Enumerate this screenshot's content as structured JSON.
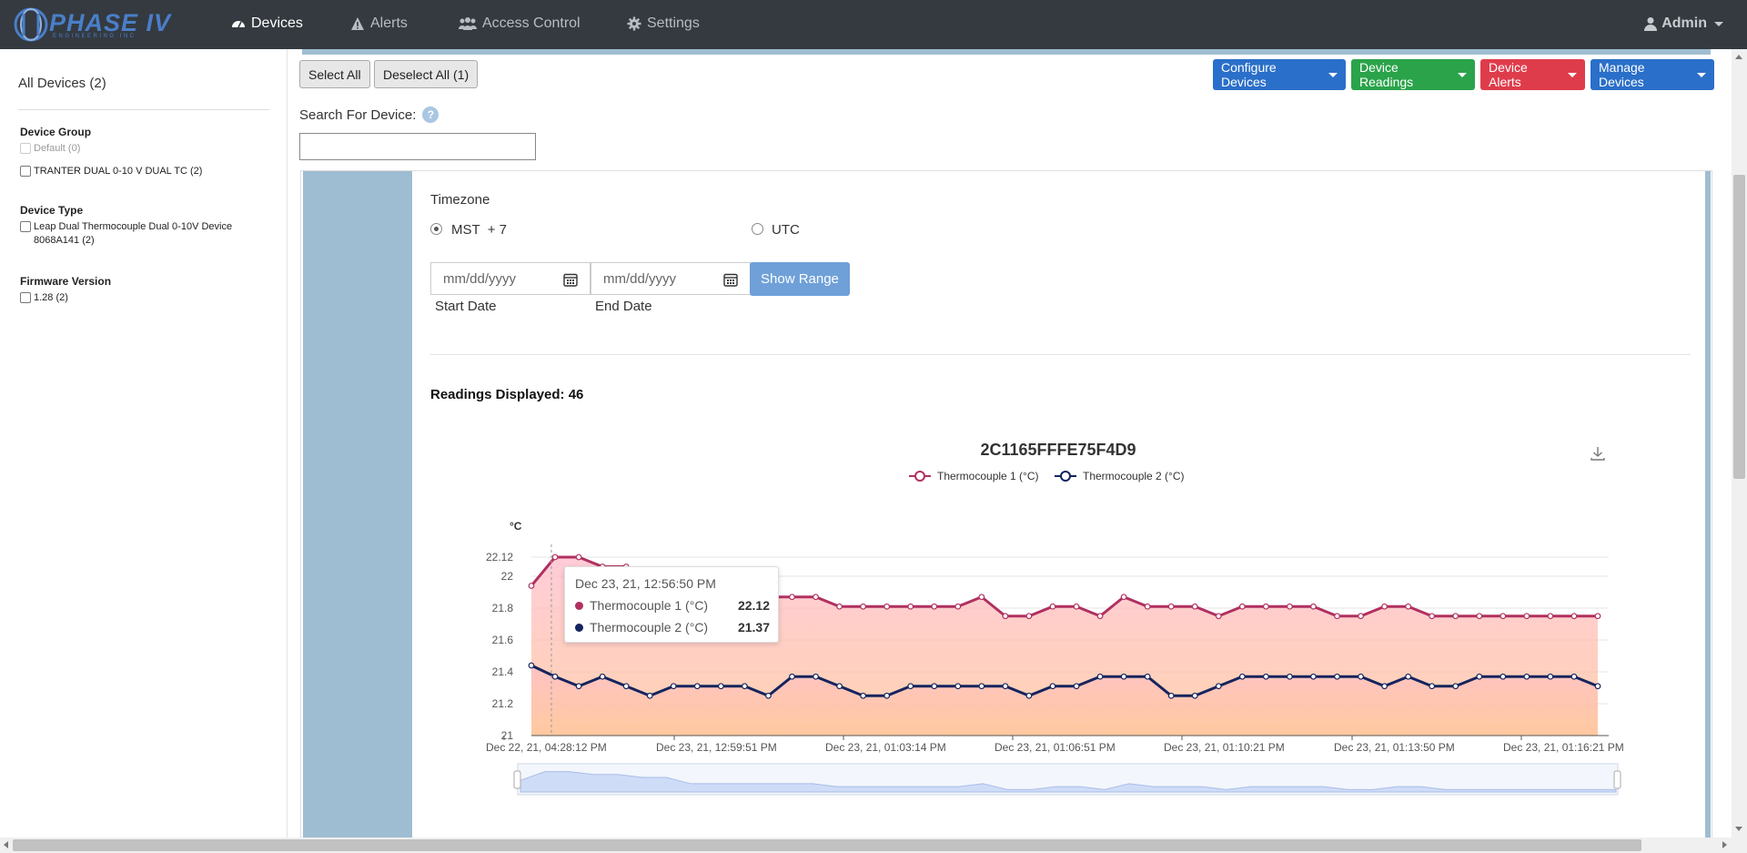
{
  "nav": {
    "logo_text": "PHASE IV",
    "logo_sub": "ENGINEERING INC",
    "items": [
      {
        "label": "Devices",
        "icon": "dashboard-icon",
        "active": true
      },
      {
        "label": "Alerts",
        "icon": "warning-icon",
        "active": false
      },
      {
        "label": "Access Control",
        "icon": "users-icon",
        "active": false
      },
      {
        "label": "Settings",
        "icon": "gear-icon",
        "active": false
      }
    ],
    "user": "Admin"
  },
  "sidebar": {
    "title": "All Devices (2)",
    "groups": [
      {
        "heading": "Device Group",
        "options": [
          {
            "label": "Default (0)",
            "disabled": true
          },
          {
            "label": "TRANTER DUAL 0-10 V DUAL TC (2)",
            "disabled": false
          }
        ]
      },
      {
        "heading": "Device Type",
        "options": [
          {
            "label": "Leap Dual Thermocouple Dual 0-10V Device 8068A141 (2)",
            "disabled": false
          }
        ]
      },
      {
        "heading": "Firmware Version",
        "options": [
          {
            "label": "1.28 (2)",
            "disabled": false
          }
        ]
      }
    ]
  },
  "toolbar": {
    "select_all": "Select All",
    "deselect_all": "Deselect All (1)",
    "configure": "Configure Devices",
    "readings": "Device Readings",
    "alerts": "Device Alerts",
    "manage": "Manage Devices",
    "colors": {
      "configure": "#2a6fc9",
      "readings": "#2aa34a",
      "alerts": "#df3c4b",
      "manage": "#2a6fc9"
    }
  },
  "search": {
    "label": "Search For Device:",
    "help": "?",
    "value": ""
  },
  "panel": {
    "timezone_label": "Timezone",
    "tz_option1": "MST  + 7",
    "tz_option2": "UTC",
    "selected_tz": "MST  + 7",
    "start_placeholder": "mm/dd/yyyy",
    "end_placeholder": "mm/dd/yyyy",
    "show_range": "Show Range",
    "start_caption": "Start Date",
    "end_caption": "End Date",
    "readings_displayed": "Readings Displayed: 46"
  },
  "tooltip": {
    "title": "Dec 23, 21, 12:56:50 PM",
    "rows": [
      {
        "name": "Thermocouple 1 (°C)",
        "value": "22.12",
        "color": "#b03060"
      },
      {
        "name": "Thermocouple 2 (°C)",
        "value": "21.37",
        "color": "#15245e"
      }
    ]
  },
  "chart_data": {
    "type": "line",
    "title": "2C1165FFFE75F4D9",
    "ylabel": "°C",
    "ylim": [
      21,
      22.2
    ],
    "yticks": [
      21,
      21.2,
      21.4,
      21.6,
      21.8,
      22,
      22.12
    ],
    "xtick_labels": [
      "Dec 22, 21, 04:28:12 PM",
      "Dec 23, 21, 12:59:51 PM",
      "Dec 23, 21, 01:03:14 PM",
      "Dec 23, 21, 01:06:51 PM",
      "Dec 23, 21, 01:10:21 PM",
      "Dec 23, 21, 01:13:50 PM",
      "Dec 23, 21, 01:16:21 PM"
    ],
    "legend_placement": "top",
    "grid": true,
    "series": [
      {
        "name": "Thermocouple 1 (°C)",
        "color": "#b03060",
        "values": [
          21.94,
          22.12,
          22.12,
          22.06,
          22.06,
          22.0,
          22.0,
          21.87,
          21.87,
          21.87,
          21.87,
          21.87,
          21.87,
          21.81,
          21.81,
          21.81,
          21.81,
          21.81,
          21.81,
          21.87,
          21.75,
          21.75,
          21.81,
          21.81,
          21.75,
          21.87,
          21.81,
          21.81,
          21.81,
          21.75,
          21.81,
          21.81,
          21.81,
          21.81,
          21.75,
          21.75,
          21.81,
          21.81,
          21.75,
          21.75,
          21.75,
          21.75,
          21.75,
          21.75,
          21.75,
          21.75
        ]
      },
      {
        "name": "Thermocouple 2 (°C)",
        "color": "#15245e",
        "values": [
          21.44,
          21.37,
          21.31,
          21.37,
          21.31,
          21.25,
          21.31,
          21.31,
          21.31,
          21.31,
          21.25,
          21.37,
          21.37,
          21.31,
          21.25,
          21.25,
          21.31,
          21.31,
          21.31,
          21.31,
          21.31,
          21.25,
          21.31,
          21.31,
          21.37,
          21.37,
          21.37,
          21.25,
          21.25,
          21.31,
          21.37,
          21.37,
          21.37,
          21.37,
          21.37,
          21.37,
          21.31,
          21.37,
          21.31,
          21.31,
          21.37,
          21.37,
          21.37,
          21.37,
          21.37,
          21.31
        ]
      }
    ]
  }
}
